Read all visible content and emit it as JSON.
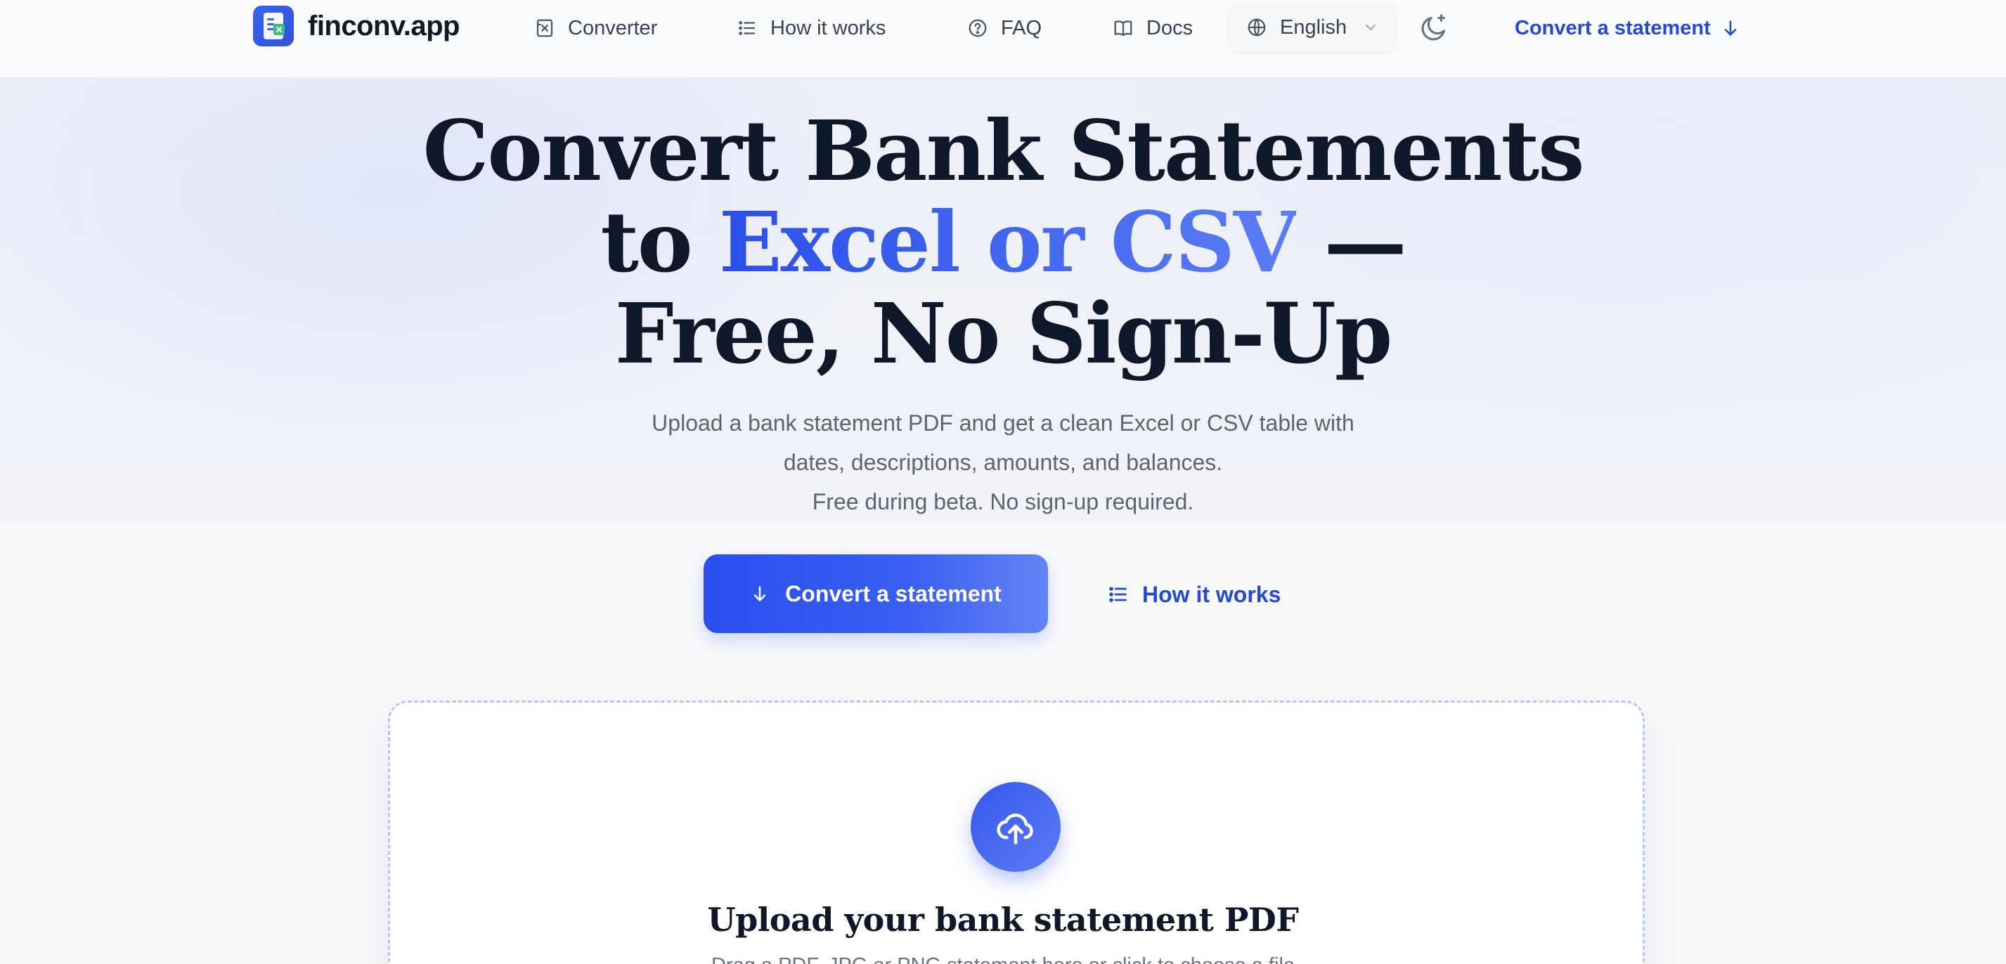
{
  "nav": {
    "brand": "finconv.app",
    "items": [
      {
        "label": "Converter",
        "icon": "spreadsheet-icon"
      },
      {
        "label": "How it works",
        "icon": "list-icon"
      },
      {
        "label": "FAQ",
        "icon": "help-circle-icon"
      },
      {
        "label": "Docs",
        "icon": "book-icon"
      }
    ],
    "language": "English",
    "theme_toggle_icon": "moon-icon",
    "cta": "Convert a statement"
  },
  "hero": {
    "title_line1": "Convert Bank Statements",
    "title_to": "to",
    "title_accent": "Excel or CSV",
    "title_dash": "—",
    "title_line3": "Free, No Sign-Up",
    "subtitle_line1": "Upload a bank statement PDF and get a clean Excel or CSV table with",
    "subtitle_line2": "dates, descriptions, amounts, and balances.",
    "subtitle_line3": "Free during beta. No sign-up required.",
    "primary_button": "Convert a statement",
    "secondary_button": "How it works"
  },
  "upload": {
    "icon": "cloud-upload-icon",
    "title": "Upload your bank statement PDF",
    "hint": "Drag a PDF, JPG or PNG statement here or click to choose a file"
  },
  "colors": {
    "accent": "#2a4fe8",
    "nav_link": "#2449d6",
    "title": "#0f172a",
    "muted": "#5b6472"
  }
}
